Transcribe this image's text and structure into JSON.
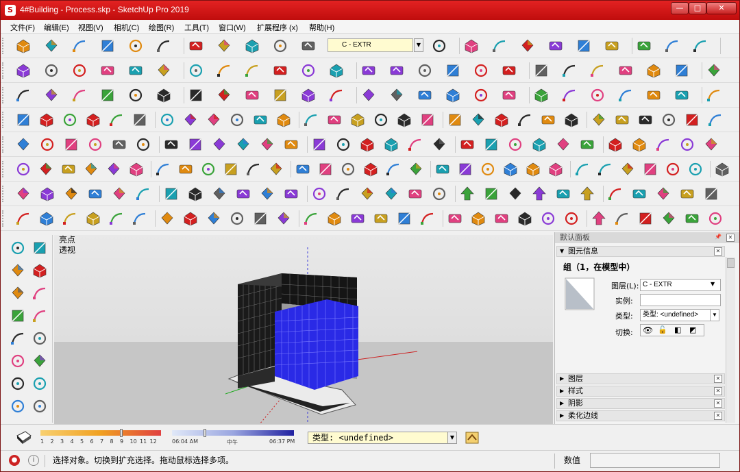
{
  "window": {
    "title": "4#Building - Process.skp - SketchUp Pro 2019",
    "app_icon_letter": "S",
    "controls": [
      "—",
      "□",
      "✕"
    ],
    "brand_color": "#d31414"
  },
  "menu": [
    "文件(F)",
    "编辑(E)",
    "视图(V)",
    "相机(C)",
    "绘图(R)",
    "工具(T)",
    "窗口(W)",
    "扩展程序 (x)",
    "帮助(H)"
  ],
  "layer_selector": {
    "value": "C - EXTR"
  },
  "toolbars": {
    "row1": [
      "new-file-icon",
      "open-folder-icon",
      "save-icon",
      "cut-icon",
      "copy-icon",
      "paste-icon",
      "erase-icon",
      "undo-icon",
      "redo-icon",
      "print-icon",
      "model-info-icon",
      "house-iso-icon",
      "house-front-icon",
      "house-top-icon",
      "house-right-icon",
      "house-back-icon",
      "house-left-icon",
      "xray-style-icon",
      "wireframe-style-icon",
      "hidden-line-style-icon",
      "shaded-style-icon",
      "shaded-texture-icon",
      "monochrome-style-icon",
      "terrain-icon",
      "sandbox-icon"
    ],
    "row2": [
      "select-arrow-icon",
      "eraser-icon",
      "pencil-icon",
      "arc-icon",
      "rectangle-icon",
      "push-pull-icon",
      "follow-me-icon",
      "move-icon",
      "rotate-icon",
      "scale-icon",
      "tape-measure-icon",
      "text-icon",
      "paint-bucket-icon",
      "orbit-icon",
      "pan-icon",
      "zoom-icon",
      "zoom-extents-icon",
      "warehouse-icon",
      "extension-warehouse-icon",
      "send-to-layout-icon",
      "ruby-icon",
      "account-icon",
      "cut-plane-icon",
      "folder-icon",
      "camera-icon"
    ],
    "row3": [
      "select-icon",
      "make-component-icon",
      "explode-icon",
      "align-left-icon",
      "align-center-icon",
      "align-right-icon",
      "distribute-icon",
      "grid-icon",
      "grid-blue-icon",
      "grid-red-icon",
      "table-icon",
      "table-blue-icon",
      "box-icon",
      "section-icon",
      "mushroom-icon",
      "checker-icon",
      "stack-icon",
      "puzzle-icon",
      "frame-icon",
      "frame2-icon",
      "connector-icon",
      "delete-link-icon",
      "window-icon",
      "pen-red-icon",
      "square-red-icon"
    ],
    "row4": [
      "orbit-icon",
      "pan-icon",
      "zoom-icon",
      "zoom-window-icon",
      "zoom-extents-icon",
      "previous-icon",
      "position-camera-icon",
      "look-around-icon",
      "walk-icon",
      "move-icon",
      "push-pull-icon",
      "rotate-icon",
      "follow-me-icon",
      "scale-icon",
      "offset-icon",
      "axes-icon",
      "section-plane-icon",
      "display-section-icon",
      "component-icon",
      "f6-icon",
      "cube-icon",
      "outliner-icon",
      "palette-icon",
      "layers-icon",
      "scenes-icon",
      "shadows-icon",
      "fog-icon",
      "styles-icon",
      "entity-icon",
      "soften-icon"
    ],
    "row5": [
      "freehand-icon",
      "bezier-icon",
      "rectangle-red-icon",
      "rotated-rect-icon",
      "circle-icon",
      "polygon-icon",
      "arc2-icon",
      "arc3-icon",
      "pie-icon",
      "curve-icon",
      "brick-icon",
      "tiles-icon",
      "terrain-a-icon",
      "terrain-b-icon",
      "bag-icon",
      "sandbox-a-icon",
      "sandbox-b-icon",
      "mat-a-icon",
      "mat-b-icon",
      "mat-c-icon",
      "mat-d-icon",
      "map-icon",
      "tag-icon",
      "hand-icon",
      "pin-icon",
      "check-icon",
      "cloud-icon",
      "link-icon",
      "trimble-icon"
    ],
    "row6": [
      "tape-icon",
      "dimension-icon",
      "protractor-icon",
      "text-label-icon",
      "axes-small-icon",
      "pot-icon",
      "plant-icon",
      "wire-icon",
      "leaf-icon",
      "pencil2-icon",
      "rect-arc-1",
      "rect-arc-2",
      "rect-arc-3",
      "rect-arc-4",
      "rect-arc-5",
      "rect-arc-6",
      "rect-arc-7",
      "rect-arc-8",
      "rect-arc-9",
      "lasso-icon",
      "rounded-shape-icon",
      "line-arrow-icon",
      "eraser-pink-icon",
      "diamond-outline-icon",
      "diamond-green-icon",
      "cube-outline-icon",
      "cube-multi-icon",
      "diamond-red-icon",
      "diamond-red2-icon",
      "cube-red-icon",
      "cubes-red-icon"
    ],
    "row7": [
      "dots-circle-icon",
      "stairs-icon",
      "bars-icon",
      "hand-grip-icon",
      "railing-icon",
      "panel-icon",
      "flag-icon",
      "stack-lines-icon",
      "nail-icon",
      "box-tool-icon",
      "roof-icon",
      "ramp-icon",
      "slope-icon",
      "truss-icon",
      "hatch-icon",
      "shade-icon",
      "shutter-icon",
      "tower-icon",
      "red-up-arrow",
      "equal-arrow",
      "blue-up-arrow",
      "red-r-arrow",
      "green-v-arrow",
      "red-n-arrow",
      "orange-x-arrow",
      "pink-f-arrow",
      "hand2-icon",
      "bucket-icon",
      "tray-icon"
    ],
    "row8": [
      "z-line-icon",
      "x-tool-icon",
      "rect-slash-icon",
      "pen-slash-icon",
      "pen2-icon",
      "circle-slash-icon",
      "octagon-slash-icon",
      "rect-grid-icon",
      "grid-red2-icon",
      "curve2-icon",
      "angle-icon",
      "dim-arrow-icon",
      "text-i-icon",
      "flag-x-icon",
      "help-icon",
      "arch-yellow-icon",
      "arrow-green-icon",
      "cube-blue-icon",
      "pyramid-purple-icon",
      "rotate-red-icon",
      "box-yellow-icon",
      "panel-cyan-icon",
      "bar-blue-icon",
      "arrows-updown-icon",
      "arrows-red-icon",
      "scale-blue-icon",
      "cube-green-icon",
      "rotate-blue-icon",
      "rotate-brown-icon",
      "ghost-icon"
    ]
  },
  "left_tools": [
    "select-arrow-icon",
    "component-icon",
    "paint-bucket-icon",
    "eraser-icon",
    "pencil-icon",
    "freehand-icon",
    "rectangle-icon",
    "rotated-rect-icon",
    "circle-icon",
    "polygon-icon",
    "arc-icon",
    "arc2-icon",
    "arc3-icon",
    "pie-icon",
    "move-icon",
    "push-pull-icon"
  ],
  "viewport": {
    "label_style": "亮点",
    "label_camera": "透视"
  },
  "tray": {
    "title": "默认面板",
    "entity_panel": {
      "header": "图元信息",
      "entity_type": "组（1，在模型中）",
      "layer_label": "图层(L):",
      "layer_value": "C - EXTR",
      "instance_label": "实例:",
      "instance_value": "",
      "type_label": "类型:",
      "type_value": "类型: <undefined>",
      "toggle_label": "切换:"
    },
    "collapsed_panels": [
      "图层",
      "样式",
      "阴影",
      "柔化边线"
    ]
  },
  "shadow_bar": {
    "months": [
      "1",
      "2",
      "3",
      "4",
      "5",
      "6",
      "7",
      "8",
      "9",
      "10",
      "11",
      "12"
    ],
    "time_start": "06:04 AM",
    "time_mid": "中午",
    "time_end": "06:37 PM"
  },
  "type_dropdown": {
    "label": "类型:",
    "value": "<undefined>"
  },
  "status": {
    "message": "选择对象。切换到扩充选择。拖动鼠标选择多项。",
    "measure_label": "数值",
    "measure_value": ""
  }
}
